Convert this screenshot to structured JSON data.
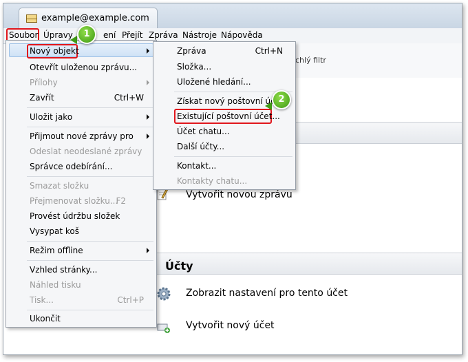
{
  "window": {
    "tab_title": "example@example.com"
  },
  "menubar": {
    "items": [
      {
        "label": "Soubor"
      },
      {
        "label": "Úpravy"
      },
      {
        "label": "Zobrazení"
      },
      {
        "label": "Přejít"
      },
      {
        "label": "Zpráva"
      },
      {
        "label": "Nástroje"
      },
      {
        "label": "Nápověda"
      }
    ],
    "visible_zobrazeni_fragment": "ení"
  },
  "main": {
    "quick_filter_fragment": "chlý filtr",
    "actions": [
      {
        "label": "Vytvořit novou zprávu",
        "icon": "pencil-icon"
      }
    ],
    "accounts_section": {
      "heading": "Účty",
      "actions": [
        {
          "label": "Zobrazit nastavení pro tento účet",
          "icon": "gear-icon"
        },
        {
          "label": "Vytvořit nový účet",
          "icon": "new-account-icon"
        }
      ]
    }
  },
  "file_menu": {
    "items": [
      {
        "label": "Nový objekt",
        "submenu": true,
        "highlighted": true
      },
      {
        "label": "Otevřít uloženou zprávu..."
      },
      {
        "label": "Přílohy",
        "disabled": true,
        "submenu": true
      },
      {
        "label": "Zavřít",
        "shortcut": "Ctrl+W"
      },
      {
        "label": "Uložit jako",
        "submenu": true
      },
      {
        "label": "Přijmout nové zprávy pro",
        "submenu": true
      },
      {
        "label": "Odeslat neodeslané zprávy",
        "disabled": true
      },
      {
        "label": "Správce odebírání..."
      },
      {
        "label": "Smazat složku",
        "disabled": true
      },
      {
        "label": "Přejmenovat složku...",
        "disabled": true,
        "shortcut": "F2"
      },
      {
        "label": "Provést údržbu složek"
      },
      {
        "label": "Vysypat koš"
      },
      {
        "label": "Režim offline",
        "submenu": true
      },
      {
        "label": "Vzhled stránky..."
      },
      {
        "label": "Náhled tisku",
        "disabled": true
      },
      {
        "label": "Tisk...",
        "disabled": true,
        "shortcut": "Ctrl+P"
      },
      {
        "label": "Ukončit"
      }
    ]
  },
  "new_submenu": {
    "items": [
      {
        "label": "Zpráva",
        "shortcut": "Ctrl+N"
      },
      {
        "label": "Složka..."
      },
      {
        "label": "Uložené hledání..."
      },
      {
        "label": "Získat nový poštovní účet..."
      },
      {
        "label": "Existující poštovní účet...",
        "highlighted": true
      },
      {
        "label": "Účet chatu..."
      },
      {
        "label": "Další účty..."
      },
      {
        "label": "Kontakt..."
      },
      {
        "label": "Kontakty chatu...",
        "disabled": true
      }
    ]
  },
  "callouts": {
    "step1": "1",
    "step2": "2"
  },
  "colors": {
    "highlight_red": "#e0151b",
    "callout_green": "#3f9b14"
  }
}
